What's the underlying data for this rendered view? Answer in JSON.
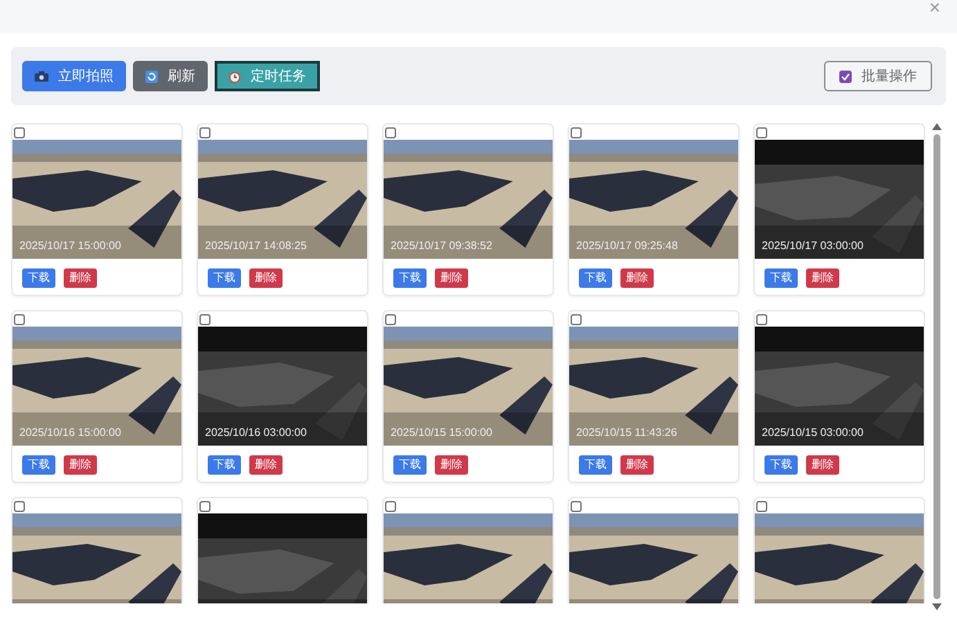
{
  "close_label": "×",
  "toolbar": {
    "buttons": [
      {
        "kind": "capture",
        "label": "立即拍照"
      },
      {
        "kind": "refresh",
        "label": "刷新"
      },
      {
        "kind": "schedule",
        "label": "定时任务"
      }
    ],
    "batch": {
      "label": "批量操作",
      "checked": true
    }
  },
  "snapshots": [
    {
      "checked": false,
      "kind": "day",
      "timestamp": "2025/10/17 15:00:00",
      "actions": [
        "下载",
        "删除"
      ]
    },
    {
      "checked": false,
      "kind": "day",
      "timestamp": "2025/10/17 14:08:25",
      "actions": [
        "下载",
        "删除"
      ]
    },
    {
      "checked": false,
      "kind": "day",
      "timestamp": "2025/10/17 09:38:52",
      "actions": [
        "下载",
        "删除"
      ]
    },
    {
      "checked": false,
      "kind": "day",
      "timestamp": "2025/10/17 09:25:48",
      "actions": [
        "下载",
        "删除"
      ]
    },
    {
      "checked": false,
      "kind": "night",
      "timestamp": "2025/10/17 03:00:00",
      "actions": [
        "下载",
        "删除"
      ]
    },
    {
      "checked": false,
      "kind": "day",
      "timestamp": "2025/10/16 15:00:00",
      "actions": [
        "下载",
        "删除"
      ]
    },
    {
      "checked": false,
      "kind": "night",
      "timestamp": "2025/10/16 03:00:00",
      "actions": [
        "下载",
        "删除"
      ]
    },
    {
      "checked": false,
      "kind": "day",
      "timestamp": "2025/10/15 15:00:00",
      "actions": [
        "下载",
        "删除"
      ]
    },
    {
      "checked": false,
      "kind": "day",
      "timestamp": "2025/10/15 11:43:26",
      "actions": [
        "下载",
        "删除"
      ]
    },
    {
      "checked": false,
      "kind": "night",
      "timestamp": "2025/10/15 03:00:00",
      "actions": [
        "下载",
        "删除"
      ]
    },
    {
      "checked": false,
      "kind": "day"
    },
    {
      "checked": false,
      "kind": "night"
    },
    {
      "checked": false,
      "kind": "day"
    },
    {
      "checked": false,
      "kind": "day"
    },
    {
      "checked": false,
      "kind": "day"
    }
  ]
}
